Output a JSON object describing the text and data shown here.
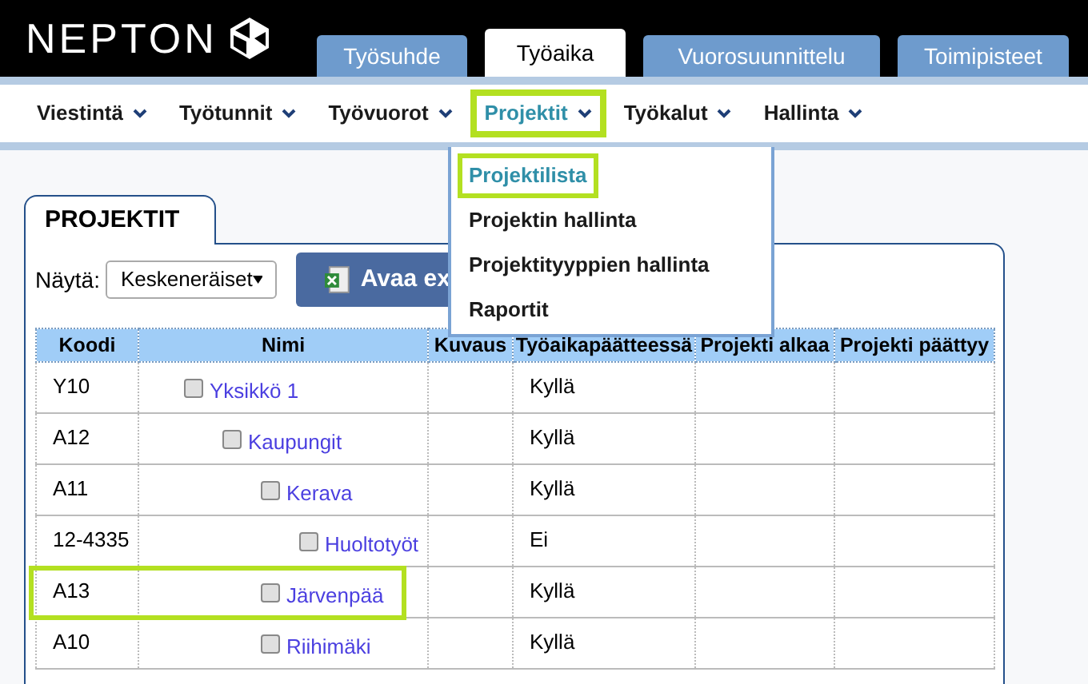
{
  "logo": {
    "text": "NEPTON"
  },
  "tabs": [
    {
      "label": "Työsuhde",
      "selected": false
    },
    {
      "label": "Työaika",
      "selected": true
    },
    {
      "label": "Vuorosuunnittelu",
      "selected": false
    },
    {
      "label": "Toimipisteet",
      "selected": false
    }
  ],
  "menu": [
    {
      "label": "Viestintä",
      "selected": false,
      "highlighted": false
    },
    {
      "label": "Työtunnit",
      "selected": false,
      "highlighted": false
    },
    {
      "label": "Työvuorot",
      "selected": false,
      "highlighted": false
    },
    {
      "label": "Projektit",
      "selected": true,
      "highlighted": true
    },
    {
      "label": "Työkalut",
      "selected": false,
      "highlighted": false
    },
    {
      "label": "Hallinta",
      "selected": false,
      "highlighted": false
    }
  ],
  "dropdown": [
    {
      "label": "Projektilista",
      "selected": true,
      "highlighted": true
    },
    {
      "label": "Projektin hallinta",
      "selected": false,
      "highlighted": false
    },
    {
      "label": "Projektityyppien hallinta",
      "selected": false,
      "highlighted": false
    },
    {
      "label": "Raportit",
      "selected": false,
      "highlighted": false
    }
  ],
  "panel": {
    "title": "PROJEKTIT",
    "filter_label": "Näytä:",
    "filter_value": "Keskeneräiset",
    "excel_button": "Avaa ex"
  },
  "table": {
    "columns": [
      "Koodi",
      "Nimi",
      "Kuvaus",
      "Työaikapäätteessä",
      "Projekti alkaa",
      "Projekti päättyy"
    ],
    "rows": [
      {
        "code": "Y10",
        "name": "Yksikkö 1",
        "terminal": "Kyllä",
        "checked": false,
        "highlighted": false,
        "children": [
          {
            "code": "A12",
            "name": "Kaupungit",
            "terminal": "Kyllä",
            "checked": false,
            "highlighted": false,
            "children": [
              {
                "code": "A11",
                "name": "Kerava",
                "terminal": "Kyllä",
                "checked": false,
                "highlighted": false,
                "children": [
                  {
                    "code": "12-4335",
                    "name": "Huoltotyöt",
                    "terminal": "Ei",
                    "checked": false,
                    "highlighted": false
                  }
                ]
              },
              {
                "code": "A13",
                "name": "Järvenpää",
                "terminal": "Kyllä",
                "checked": false,
                "highlighted": true
              },
              {
                "code": "A10",
                "name": "Riihimäki",
                "terminal": "Kyllä",
                "checked": false,
                "highlighted": false
              }
            ]
          }
        ]
      }
    ]
  }
}
